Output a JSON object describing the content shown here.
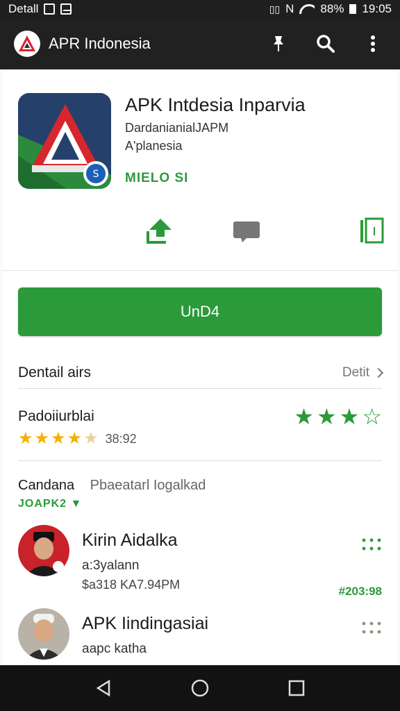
{
  "status_bar": {
    "left_label": "Detall",
    "signal_text": "N",
    "battery": "88%",
    "time": "19:05"
  },
  "app_bar": {
    "title": "APR Indonesia",
    "icons": [
      "brand-logo-icon",
      "pin-icon",
      "search-icon",
      "more-vert-icon"
    ]
  },
  "app": {
    "name": "APK Intdesia Inparvia",
    "developer": "DardanianialJAPM",
    "category": "A'planesia",
    "badge": "MIELO SI",
    "quick_actions": [
      "share-icon",
      "comment-icon",
      "bookmark-icon"
    ]
  },
  "install_label": "UnD4",
  "details": {
    "label": "Dentail airs",
    "link": "Detit"
  },
  "rating": {
    "title": "Padoiiurblai",
    "count": "38:92",
    "stars_small": 4.5,
    "stars_big": 3,
    "stars_big_total": 4
  },
  "comments": {
    "title": "Candana",
    "subtitle": "Pbaeatarl Iogalkad",
    "tag": "JOAPK2"
  },
  "reviews": [
    {
      "name": "Kirin Aidalka",
      "handle": "a:3yalann",
      "meta": "$a318 KA7.94PM",
      "score": "#203:98"
    },
    {
      "name": "APK Iindingasiai",
      "handle": "aapc katha",
      "meta": "",
      "score": ""
    }
  ],
  "colors": {
    "accent": "#2a9a3a",
    "appbar": "#212121",
    "star": "#f3b100"
  }
}
